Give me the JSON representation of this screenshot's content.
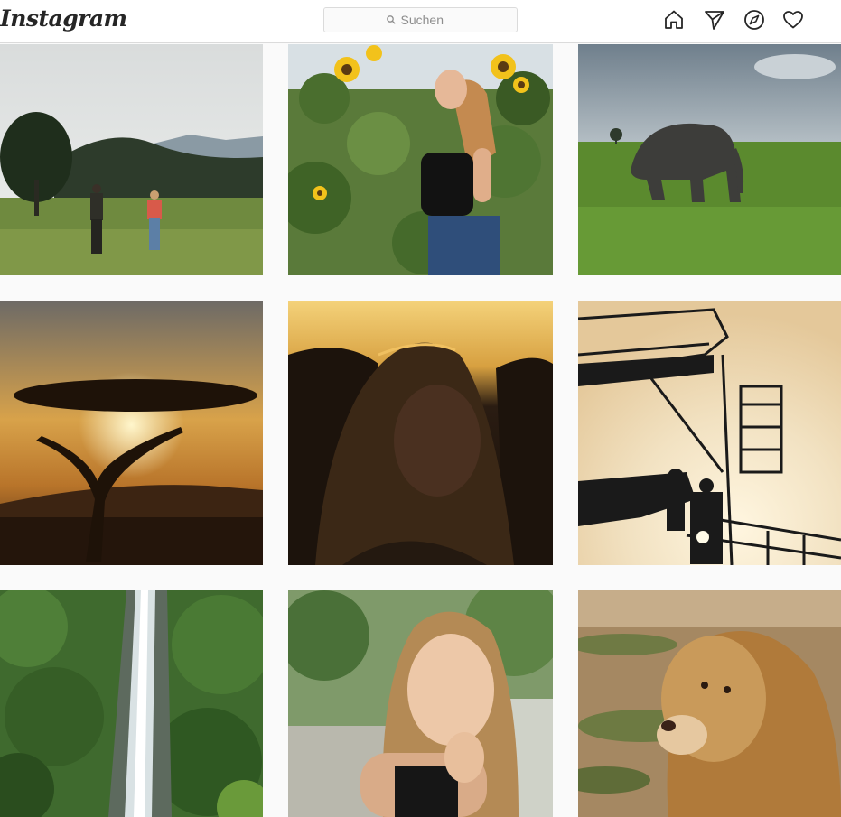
{
  "header": {
    "logo": "Instagram",
    "search": {
      "placeholder": "Suchen",
      "icon": "search-icon"
    },
    "nav_icons": [
      "home-icon",
      "direct-message-icon",
      "explore-icon",
      "activity-heart-icon"
    ]
  },
  "posts": [
    {
      "subject": "safari-walk",
      "row": 1,
      "col": 1
    },
    {
      "subject": "sunflowers-portrait",
      "row": 1,
      "col": 2
    },
    {
      "subject": "elephant",
      "row": 1,
      "col": 3
    },
    {
      "subject": "acacia-sunset",
      "row": 2,
      "col": 1
    },
    {
      "subject": "backlit-portrait",
      "row": 2,
      "col": 2
    },
    {
      "subject": "watchtower-silhouette",
      "row": 2,
      "col": 3
    },
    {
      "subject": "waterfall",
      "row": 3,
      "col": 1
    },
    {
      "subject": "smiling-portrait",
      "row": 3,
      "col": 2
    },
    {
      "subject": "lion",
      "row": 3,
      "col": 3
    }
  ],
  "colors": {
    "background": "#fafafa",
    "header": "#ffffff",
    "border": "#dbdbdb",
    "icon": "#262626"
  }
}
